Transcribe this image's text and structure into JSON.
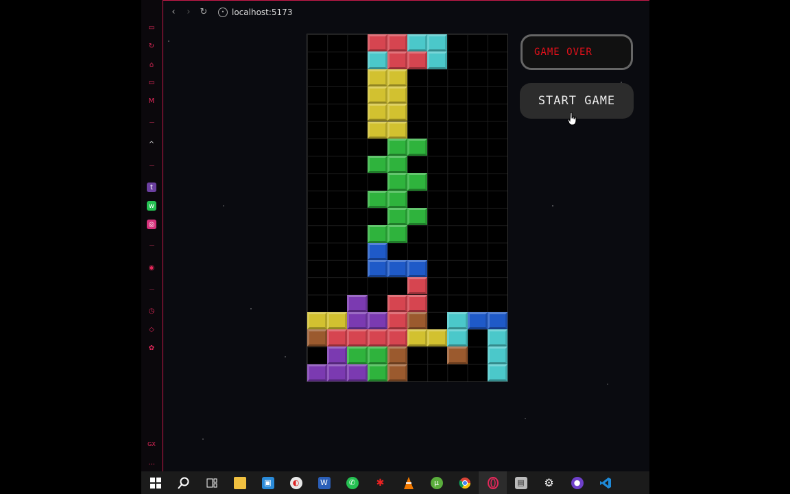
{
  "browser": {
    "url": "localhost:5173",
    "back_icon": "back-icon",
    "forward_icon": "forward-icon",
    "reload_icon": "reload-icon"
  },
  "sidebar": {
    "icons": [
      "games-icon",
      "refresh-icon",
      "bot-icon",
      "monitor-icon",
      "mail-icon",
      "arrow-up-icon",
      "twitch-icon",
      "whatsapp-icon",
      "instagram-icon",
      "play-icon",
      "clock-icon",
      "cube-icon",
      "settings-icon",
      "more-icon"
    ]
  },
  "game": {
    "status_text": "GAME OVER",
    "start_label": "START GAME",
    "board_cols": 10,
    "board_rows": 20,
    "colors": {
      "R": "#d64550",
      "C": "#4bc8ca",
      "Y": "#d2c130",
      "G": "#2fb33d",
      "B": "#1f5ac8",
      "P": "#7b3ab1",
      "O": "#9b5a2e"
    },
    "grid": [
      "...RRCC...",
      "...CRRC...",
      "...YY.....",
      "...YY.....",
      "...YY.....",
      "...YY.....",
      "....GG....",
      "...GG.....",
      "....GG....",
      "...GG.....",
      "....GG....",
      "...GG.....",
      "...B......",
      "...BBB....",
      ".....R....",
      "..P.RR....",
      "YYPPRO.CBB",
      "ORRRRYYC.C",
      ".PGGO..O.C",
      "PPPGO....C"
    ]
  },
  "taskbar": {
    "icons": [
      "windows-start-icon",
      "search-icon",
      "task-view-icon",
      "file-explorer-icon",
      "store-icon",
      "paint-icon",
      "word-icon",
      "whatsapp-icon",
      "spider-icon",
      "vlc-icon",
      "utorrent-icon",
      "chrome-icon",
      "opera-gx-icon",
      "server-icon",
      "settings-icon",
      "github-icon",
      "vscode-icon"
    ]
  }
}
